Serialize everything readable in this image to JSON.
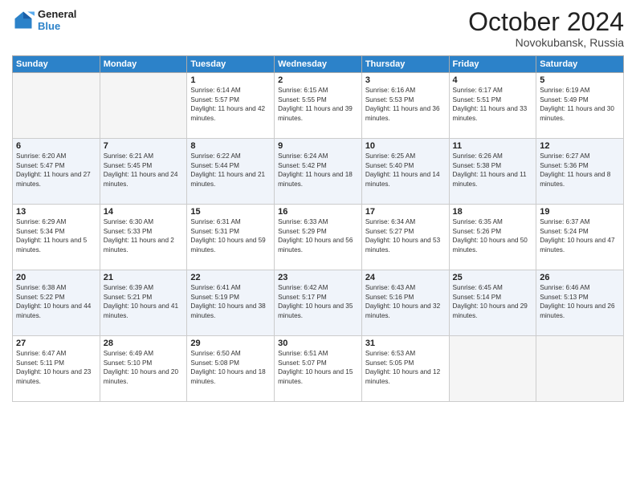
{
  "header": {
    "logo_line1": "General",
    "logo_line2": "Blue",
    "month": "October 2024",
    "location": "Novokubansk, Russia"
  },
  "days_of_week": [
    "Sunday",
    "Monday",
    "Tuesday",
    "Wednesday",
    "Thursday",
    "Friday",
    "Saturday"
  ],
  "weeks": [
    [
      {
        "day": "",
        "info": ""
      },
      {
        "day": "",
        "info": ""
      },
      {
        "day": "1",
        "info": "Sunrise: 6:14 AM\nSunset: 5:57 PM\nDaylight: 11 hours and 42 minutes."
      },
      {
        "day": "2",
        "info": "Sunrise: 6:15 AM\nSunset: 5:55 PM\nDaylight: 11 hours and 39 minutes."
      },
      {
        "day": "3",
        "info": "Sunrise: 6:16 AM\nSunset: 5:53 PM\nDaylight: 11 hours and 36 minutes."
      },
      {
        "day": "4",
        "info": "Sunrise: 6:17 AM\nSunset: 5:51 PM\nDaylight: 11 hours and 33 minutes."
      },
      {
        "day": "5",
        "info": "Sunrise: 6:19 AM\nSunset: 5:49 PM\nDaylight: 11 hours and 30 minutes."
      }
    ],
    [
      {
        "day": "6",
        "info": "Sunrise: 6:20 AM\nSunset: 5:47 PM\nDaylight: 11 hours and 27 minutes."
      },
      {
        "day": "7",
        "info": "Sunrise: 6:21 AM\nSunset: 5:45 PM\nDaylight: 11 hours and 24 minutes."
      },
      {
        "day": "8",
        "info": "Sunrise: 6:22 AM\nSunset: 5:44 PM\nDaylight: 11 hours and 21 minutes."
      },
      {
        "day": "9",
        "info": "Sunrise: 6:24 AM\nSunset: 5:42 PM\nDaylight: 11 hours and 18 minutes."
      },
      {
        "day": "10",
        "info": "Sunrise: 6:25 AM\nSunset: 5:40 PM\nDaylight: 11 hours and 14 minutes."
      },
      {
        "day": "11",
        "info": "Sunrise: 6:26 AM\nSunset: 5:38 PM\nDaylight: 11 hours and 11 minutes."
      },
      {
        "day": "12",
        "info": "Sunrise: 6:27 AM\nSunset: 5:36 PM\nDaylight: 11 hours and 8 minutes."
      }
    ],
    [
      {
        "day": "13",
        "info": "Sunrise: 6:29 AM\nSunset: 5:34 PM\nDaylight: 11 hours and 5 minutes."
      },
      {
        "day": "14",
        "info": "Sunrise: 6:30 AM\nSunset: 5:33 PM\nDaylight: 11 hours and 2 minutes."
      },
      {
        "day": "15",
        "info": "Sunrise: 6:31 AM\nSunset: 5:31 PM\nDaylight: 10 hours and 59 minutes."
      },
      {
        "day": "16",
        "info": "Sunrise: 6:33 AM\nSunset: 5:29 PM\nDaylight: 10 hours and 56 minutes."
      },
      {
        "day": "17",
        "info": "Sunrise: 6:34 AM\nSunset: 5:27 PM\nDaylight: 10 hours and 53 minutes."
      },
      {
        "day": "18",
        "info": "Sunrise: 6:35 AM\nSunset: 5:26 PM\nDaylight: 10 hours and 50 minutes."
      },
      {
        "day": "19",
        "info": "Sunrise: 6:37 AM\nSunset: 5:24 PM\nDaylight: 10 hours and 47 minutes."
      }
    ],
    [
      {
        "day": "20",
        "info": "Sunrise: 6:38 AM\nSunset: 5:22 PM\nDaylight: 10 hours and 44 minutes."
      },
      {
        "day": "21",
        "info": "Sunrise: 6:39 AM\nSunset: 5:21 PM\nDaylight: 10 hours and 41 minutes."
      },
      {
        "day": "22",
        "info": "Sunrise: 6:41 AM\nSunset: 5:19 PM\nDaylight: 10 hours and 38 minutes."
      },
      {
        "day": "23",
        "info": "Sunrise: 6:42 AM\nSunset: 5:17 PM\nDaylight: 10 hours and 35 minutes."
      },
      {
        "day": "24",
        "info": "Sunrise: 6:43 AM\nSunset: 5:16 PM\nDaylight: 10 hours and 32 minutes."
      },
      {
        "day": "25",
        "info": "Sunrise: 6:45 AM\nSunset: 5:14 PM\nDaylight: 10 hours and 29 minutes."
      },
      {
        "day": "26",
        "info": "Sunrise: 6:46 AM\nSunset: 5:13 PM\nDaylight: 10 hours and 26 minutes."
      }
    ],
    [
      {
        "day": "27",
        "info": "Sunrise: 6:47 AM\nSunset: 5:11 PM\nDaylight: 10 hours and 23 minutes."
      },
      {
        "day": "28",
        "info": "Sunrise: 6:49 AM\nSunset: 5:10 PM\nDaylight: 10 hours and 20 minutes."
      },
      {
        "day": "29",
        "info": "Sunrise: 6:50 AM\nSunset: 5:08 PM\nDaylight: 10 hours and 18 minutes."
      },
      {
        "day": "30",
        "info": "Sunrise: 6:51 AM\nSunset: 5:07 PM\nDaylight: 10 hours and 15 minutes."
      },
      {
        "day": "31",
        "info": "Sunrise: 6:53 AM\nSunset: 5:05 PM\nDaylight: 10 hours and 12 minutes."
      },
      {
        "day": "",
        "info": ""
      },
      {
        "day": "",
        "info": ""
      }
    ]
  ]
}
